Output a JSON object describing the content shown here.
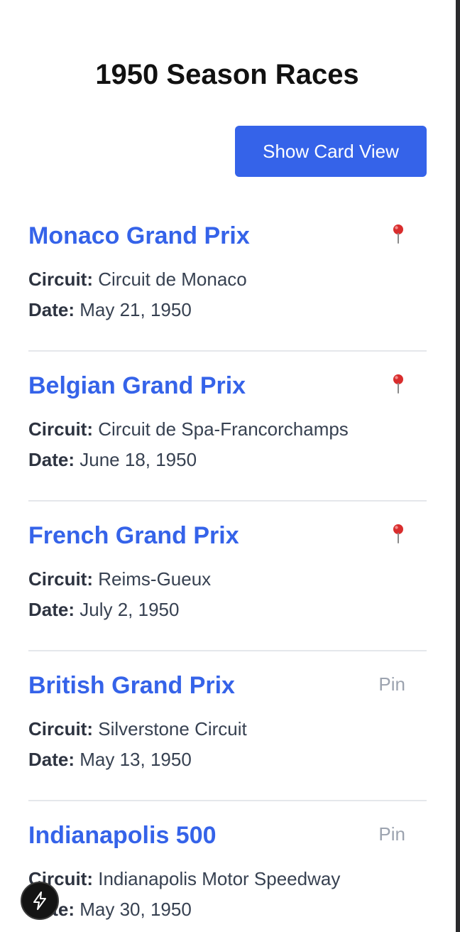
{
  "page": {
    "title": "1950 Season Races"
  },
  "toolbar": {
    "toggle_view_label": "Show Card View"
  },
  "labels": {
    "circuit": "Circuit:",
    "date": "Date:"
  },
  "colors": {
    "accent": "#3563e9",
    "pin_text": "#9ca3af",
    "divider": "#e5e7eb"
  },
  "races": [
    {
      "name": "Monaco Grand Prix",
      "circuit": "Circuit de Monaco",
      "date": "May 21, 1950",
      "pinned": true,
      "pin_label": "",
      "pin_icon": "pushpin-icon"
    },
    {
      "name": "Belgian Grand Prix",
      "circuit": "Circuit de Spa-Francorchamps",
      "date": "June 18, 1950",
      "pinned": true,
      "pin_label": "",
      "pin_icon": "pushpin-icon"
    },
    {
      "name": "French Grand Prix",
      "circuit": "Reims-Gueux",
      "date": "July 2, 1950",
      "pinned": true,
      "pin_label": "",
      "pin_icon": "pushpin-icon"
    },
    {
      "name": "British Grand Prix",
      "circuit": "Silverstone Circuit",
      "date": "May 13, 1950",
      "pinned": false,
      "pin_label": "Pin",
      "pin_icon": ""
    },
    {
      "name": "Indianapolis 500",
      "circuit": "Indianapolis Motor Speedway",
      "date": "May 30, 1950",
      "pinned": false,
      "pin_label": "Pin",
      "pin_icon": ""
    }
  ],
  "floating_action": {
    "icon": "lightning-bolt-icon"
  }
}
